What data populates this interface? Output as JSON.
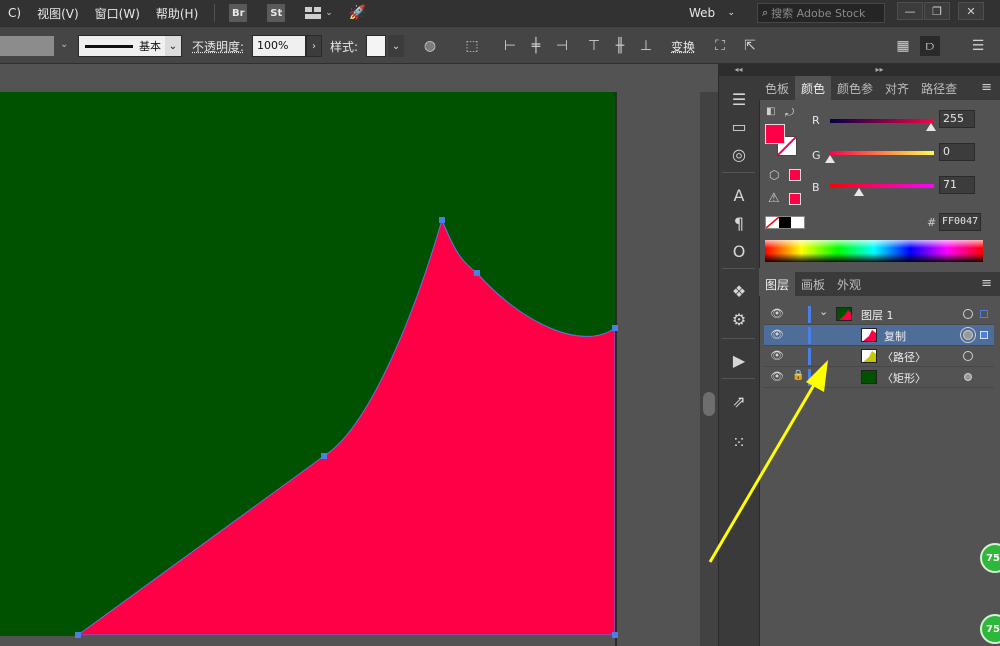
{
  "menubar": {
    "items": [
      "C)",
      "视图(V)",
      "窗口(W)",
      "帮助(H)"
    ],
    "app_badges": [
      "Br",
      "St"
    ],
    "workspace": "Web",
    "search_placeholder": "搜索 Adobe Stock",
    "window_buttons": [
      "—",
      "❐",
      "✕"
    ]
  },
  "controlbar": {
    "stroke_style_label": "基本",
    "opacity_label": "不透明度:",
    "opacity_value": "100%",
    "style_label": "样式:",
    "transform_label": "变换"
  },
  "canvas": {
    "artboard_color": "#005200",
    "shape_color": "#ff0047",
    "path_color": "#4a7fe6"
  },
  "dock": {
    "icons": [
      "menu-lines-icon",
      "gradient-icon",
      "appearance-circles-icon",
      "character-icon",
      "paragraph-icon",
      "opentype-icon",
      "symbols-icon",
      "settings-gear-icon",
      "play-actions-icon",
      "export-icon",
      "artboard-grid-icon"
    ]
  },
  "color_panel": {
    "tabs": [
      "色板",
      "颜色",
      "颜色参",
      "对齐",
      "路径查"
    ],
    "active_tab": "颜色",
    "channels": [
      {
        "label": "R",
        "value": "255",
        "fraction": 1.0
      },
      {
        "label": "G",
        "value": "0",
        "fraction": 0.0
      },
      {
        "label": "B",
        "value": "71",
        "fraction": 0.28
      }
    ],
    "hex_label": "#",
    "hex_value": "FF0047",
    "fill_color": "#ff0047"
  },
  "layers_panel": {
    "tabs": [
      "图层",
      "画板",
      "外观"
    ],
    "active_tab": "图层",
    "rows": [
      {
        "name": "图层 1",
        "selected": false,
        "locked": false,
        "expand": "⌄"
      },
      {
        "name": "复制",
        "selected": true,
        "locked": false
      },
      {
        "name": "〈路径〉",
        "selected": false,
        "locked": false
      },
      {
        "name": "〈矩形〉",
        "selected": false,
        "locked": true
      }
    ]
  },
  "badges": [
    "75",
    "75"
  ]
}
